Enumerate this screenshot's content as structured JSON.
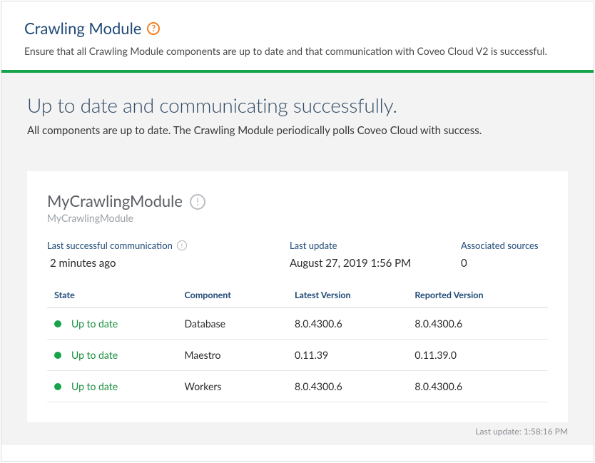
{
  "header": {
    "title": "Crawling Module",
    "subtitle": "Ensure that all Crawling Module components are up to date and that communication with Coveo Cloud V2 is successful."
  },
  "status": {
    "title": "Up to date and communicating successfully.",
    "subtitle": "All components are up to date. The Crawling Module periodically polls Coveo Cloud with success."
  },
  "module": {
    "name": "MyCrawlingModule",
    "id": "MyCrawlingModule",
    "last_comm_label": "Last successful communication",
    "last_comm_value": "2 minutes ago",
    "last_update_label": "Last update",
    "last_update_value": "August 27, 2019 1:56 PM",
    "assoc_sources_label": "Associated sources",
    "assoc_sources_value": "0"
  },
  "table": {
    "headers": {
      "state": "State",
      "component": "Component",
      "latest": "Latest Version",
      "reported": "Reported Version"
    },
    "rows": [
      {
        "state": "Up to date",
        "component": "Database",
        "latest": "8.0.4300.6",
        "reported": "8.0.4300.6"
      },
      {
        "state": "Up to date",
        "component": "Maestro",
        "latest": "0.11.39",
        "reported": "0.11.39.0"
      },
      {
        "state": "Up to date",
        "component": "Workers",
        "latest": "8.0.4300.6",
        "reported": "8.0.4300.6"
      }
    ]
  },
  "footer": {
    "last_update": "Last update: 1:58:16 PM"
  }
}
